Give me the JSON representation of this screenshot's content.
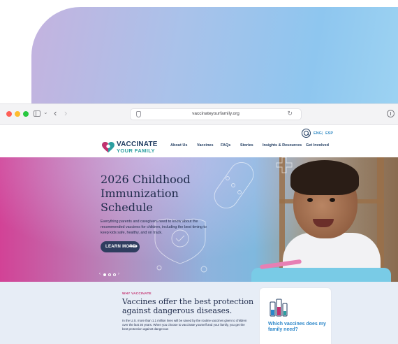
{
  "browser": {
    "url": "vaccinateyourfamily.org"
  },
  "site": {
    "logo": {
      "line1": "VACCINATE",
      "line2": "YOUR FAMILY"
    },
    "nav": [
      {
        "label": "About Us"
      },
      {
        "label": "Vaccines"
      },
      {
        "label": "FAQs"
      },
      {
        "label": "Stories"
      },
      {
        "label": "Insights & Resources"
      },
      {
        "label": "Get Involved"
      }
    ],
    "language": {
      "active": "ENG",
      "separator": "|",
      "alternate": "ESP"
    }
  },
  "hero": {
    "title_line1": "2026 Childhood",
    "title_line2": "Immunization",
    "title_line3": "Schedule",
    "description": "Everything parents and caregivers need to know about the recommended vaccines for children, including the best timing to keep kids safe, healthy, and on track.",
    "cta_label": "LEARN MORE",
    "cta_arrow": "⟶",
    "carousel": {
      "prev": "‹",
      "next": "›",
      "slide_count": 3,
      "active_index": 0
    }
  },
  "why": {
    "eyebrow": "WHY VACCINATE",
    "title": "Vaccines offer the best protection against dangerous diseases.",
    "body": "In the U.S. more than 1.1 million lives will be saved by the routine vaccines given to children over the last 30 years. When you choose to vaccinate yourself and your family, you get the best protection against dangerous"
  },
  "side_card": {
    "title": "Which vaccines does my family need?"
  },
  "colors": {
    "navy": "#1e3a5f",
    "teal": "#2c9ea0",
    "magenta": "#c3316f",
    "link_blue": "#2b86c9"
  }
}
